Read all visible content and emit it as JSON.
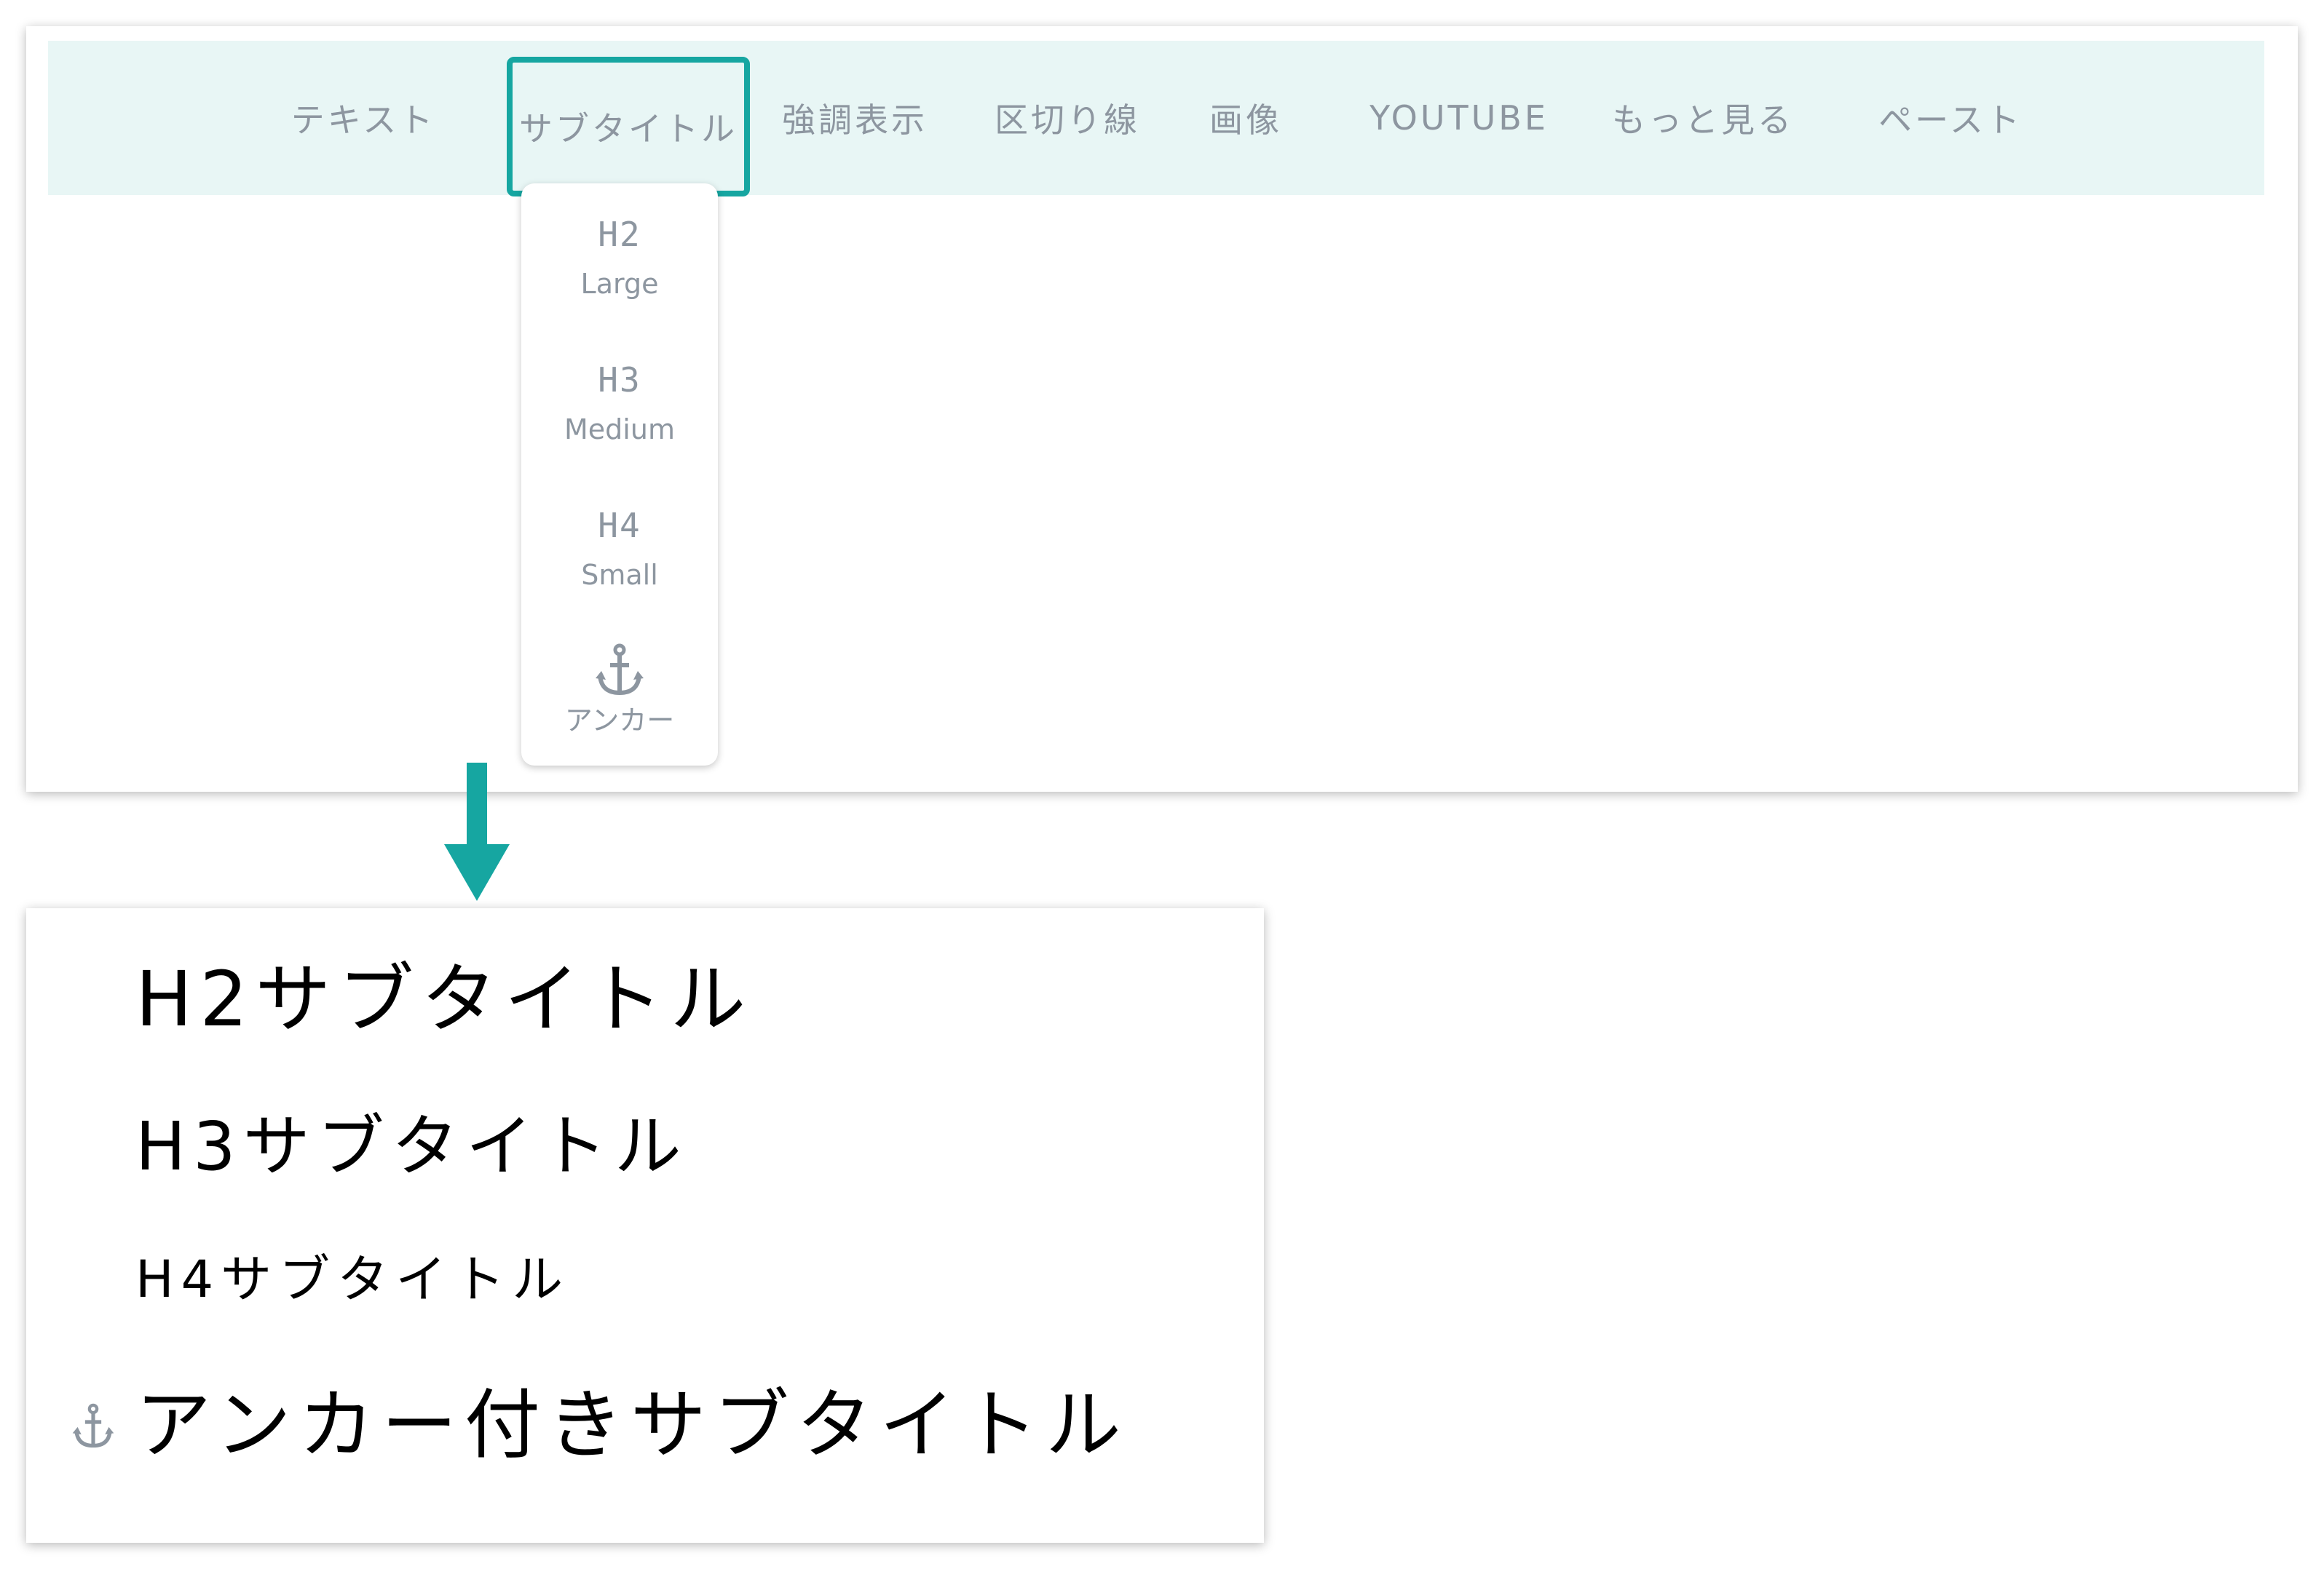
{
  "toolbar": {
    "items": [
      {
        "label": "テキスト"
      },
      {
        "label": "サブタイトル"
      },
      {
        "label": "強調表示"
      },
      {
        "label": "区切り線"
      },
      {
        "label": "画像"
      },
      {
        "label": "YOUTUBE"
      },
      {
        "label": "もっと見る"
      },
      {
        "label": "ペースト"
      }
    ]
  },
  "dropdown": {
    "items": [
      {
        "tag": "H2",
        "label": "Large"
      },
      {
        "tag": "H3",
        "label": "Medium"
      },
      {
        "tag": "H4",
        "label": "Small"
      },
      {
        "icon": "anchor-icon",
        "label": "アンカー"
      }
    ]
  },
  "result": {
    "h2": "H2サブタイトル",
    "h3": "H3サブタイトル",
    "h4": "H4サブタイトル",
    "anchor": "アンカー付きサブタイトル"
  },
  "colors": {
    "accent": "#16a6a1",
    "toolbar_bg": "#e8f6f5",
    "muted_text": "#8d96a0"
  }
}
